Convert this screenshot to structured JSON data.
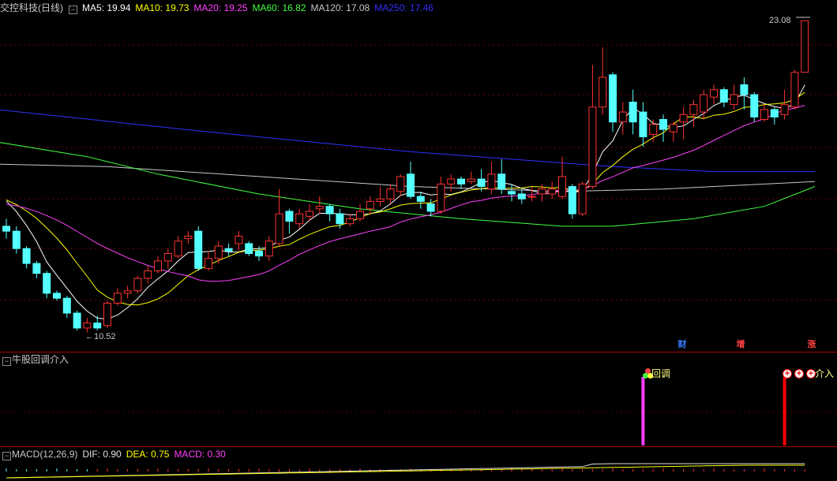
{
  "title": "交控科技(日线)",
  "ma_legend": [
    {
      "label": "MA5: 19.94",
      "color": "#ffffff"
    },
    {
      "label": "MA10: 19.73",
      "color": "#ffff00"
    },
    {
      "label": "MA20: 19.25",
      "color": "#ff40ff"
    },
    {
      "label": "MA60: 16.82",
      "color": "#40ff40"
    },
    {
      "label": "MA120: 17.08",
      "color": "#c8c8c8"
    },
    {
      "label": "MA250: 17.46",
      "color": "#3030ff"
    }
  ],
  "high_label": "23.08",
  "low_label": "10.52",
  "badges": [
    {
      "label": "财",
      "color": "#3a7bff"
    },
    {
      "label": "增",
      "color": "#ff4040"
    },
    {
      "label": "涨",
      "color": "#ff4040"
    }
  ],
  "indicator": {
    "title": "牛股回调介入",
    "pullback_label": "回调",
    "entry_label": "介入",
    "pullback_color": "#ff40ff",
    "entry_color": "#ff0000"
  },
  "macd": {
    "title": "MACD(12,26,9)",
    "dif": "DIF: 0.90",
    "dea": "DEA: 0.75",
    "macd": "MACD: 0.30",
    "dif_color": "#e0e0e0",
    "dea_color": "#ffff00",
    "macd_color": "#ff40ff"
  },
  "colors": {
    "up": "#ff3232",
    "down": "#54ffff"
  },
  "chart_data": {
    "type": "candlestick",
    "ohlc": [
      [
        14.8,
        14.6,
        15.1,
        14.3
      ],
      [
        14.6,
        13.9,
        14.8,
        13.7
      ],
      [
        13.9,
        13.3,
        14.0,
        13.1
      ],
      [
        13.3,
        12.9,
        13.4,
        12.7
      ],
      [
        12.9,
        12.1,
        13.0,
        11.9
      ],
      [
        12.1,
        11.9,
        12.2,
        11.8
      ],
      [
        11.9,
        11.3,
        12.0,
        11.1
      ],
      [
        11.3,
        10.7,
        11.4,
        10.6
      ],
      [
        10.7,
        10.9,
        11.1,
        10.52
      ],
      [
        10.9,
        10.7,
        11.2,
        10.6
      ],
      [
        10.8,
        11.7,
        11.8,
        10.7
      ],
      [
        11.7,
        12.1,
        12.3,
        11.6
      ],
      [
        12.1,
        12.2,
        12.4,
        11.9
      ],
      [
        12.2,
        12.7,
        12.8,
        12.1
      ],
      [
        12.7,
        13.0,
        13.2,
        12.5
      ],
      [
        13.0,
        13.4,
        13.6,
        12.9
      ],
      [
        13.4,
        13.7,
        13.9,
        13.1
      ],
      [
        13.6,
        14.2,
        14.4,
        13.5
      ],
      [
        14.3,
        14.4,
        14.6,
        14.1
      ],
      [
        14.6,
        13.1,
        14.8,
        13.0
      ],
      [
        13.1,
        13.5,
        13.8,
        13.0
      ],
      [
        13.5,
        14.0,
        14.2,
        13.3
      ],
      [
        13.9,
        13.8,
        14.1,
        13.6
      ],
      [
        14.1,
        14.4,
        14.6,
        13.8
      ],
      [
        14.1,
        13.7,
        14.2,
        13.6
      ],
      [
        13.8,
        13.6,
        14.0,
        13.4
      ],
      [
        13.6,
        14.2,
        14.4,
        13.4
      ],
      [
        14.1,
        15.3,
        16.3,
        14.0
      ],
      [
        15.4,
        15.0,
        15.5,
        14.5
      ],
      [
        14.9,
        15.3,
        15.5,
        14.7
      ],
      [
        15.2,
        15.4,
        15.7,
        15.0
      ],
      [
        15.5,
        15.6,
        16.0,
        15.3
      ],
      [
        15.6,
        15.3,
        15.7,
        15.0
      ],
      [
        15.3,
        14.9,
        15.5,
        14.7
      ],
      [
        14.9,
        15.1,
        15.3,
        14.8
      ],
      [
        15.1,
        15.4,
        15.7,
        15.0
      ],
      [
        15.5,
        15.8,
        16.0,
        15.3
      ],
      [
        15.8,
        15.9,
        16.4,
        15.6
      ],
      [
        15.9,
        16.3,
        16.5,
        15.7
      ],
      [
        16.2,
        16.8,
        16.9,
        16.0
      ],
      [
        16.9,
        16.0,
        17.4,
        15.9
      ],
      [
        16.0,
        15.8,
        16.2,
        15.5
      ],
      [
        15.7,
        15.4,
        15.9,
        15.2
      ],
      [
        15.4,
        16.5,
        16.8,
        15.3
      ],
      [
        16.5,
        16.7,
        16.9,
        16.2
      ],
      [
        16.7,
        16.5,
        16.8,
        16.3
      ],
      [
        16.6,
        16.7,
        17.0,
        16.5
      ],
      [
        16.7,
        16.4,
        17.1,
        16.2
      ],
      [
        16.3,
        16.9,
        17.4,
        16.1
      ],
      [
        16.9,
        16.3,
        17.5,
        16.1
      ],
      [
        16.2,
        16.1,
        16.5,
        15.8
      ],
      [
        16.1,
        15.9,
        16.3,
        15.7
      ],
      [
        16.0,
        16.0,
        16.4,
        15.8
      ],
      [
        16.1,
        16.3,
        16.5,
        15.8
      ],
      [
        16.1,
        16.3,
        16.6,
        15.9
      ],
      [
        16.0,
        16.8,
        17.6,
        15.9
      ],
      [
        16.4,
        15.3,
        16.5,
        15.1
      ],
      [
        15.3,
        16.5,
        16.6,
        15.2
      ],
      [
        16.4,
        19.6,
        21.3,
        16.3
      ],
      [
        19.6,
        20.8,
        22.0,
        19.3
      ],
      [
        20.9,
        19.0,
        21.0,
        18.6
      ],
      [
        19.0,
        19.4,
        19.8,
        18.5
      ],
      [
        19.8,
        19.0,
        20.3,
        18.5
      ],
      [
        19.4,
        18.4,
        19.8,
        18.0
      ],
      [
        18.5,
        18.9,
        19.1,
        18.2
      ],
      [
        19.1,
        18.7,
        19.3,
        18.2
      ],
      [
        18.6,
        18.9,
        19.0,
        18.2
      ],
      [
        19.0,
        19.3,
        19.6,
        18.3
      ],
      [
        19.3,
        19.7,
        19.9,
        18.8
      ],
      [
        19.4,
        20.1,
        20.3,
        19.1
      ],
      [
        20.0,
        20.3,
        20.5,
        19.7
      ],
      [
        20.3,
        19.8,
        20.4,
        19.6
      ],
      [
        19.7,
        20.1,
        20.5,
        19.5
      ],
      [
        20.5,
        20.1,
        20.8,
        19.5
      ],
      [
        20.1,
        19.2,
        20.2,
        19.0
      ],
      [
        19.1,
        19.5,
        19.7,
        19.0
      ],
      [
        19.5,
        19.2,
        19.6,
        18.9
      ],
      [
        19.3,
        19.7,
        20.3,
        19.1
      ],
      [
        19.6,
        21.0,
        21.1,
        19.5
      ],
      [
        21.0,
        23.08,
        23.08,
        21.0
      ]
    ],
    "ylim": [
      10,
      23.5
    ],
    "annotations": [
      "23.08",
      "10.52"
    ]
  }
}
